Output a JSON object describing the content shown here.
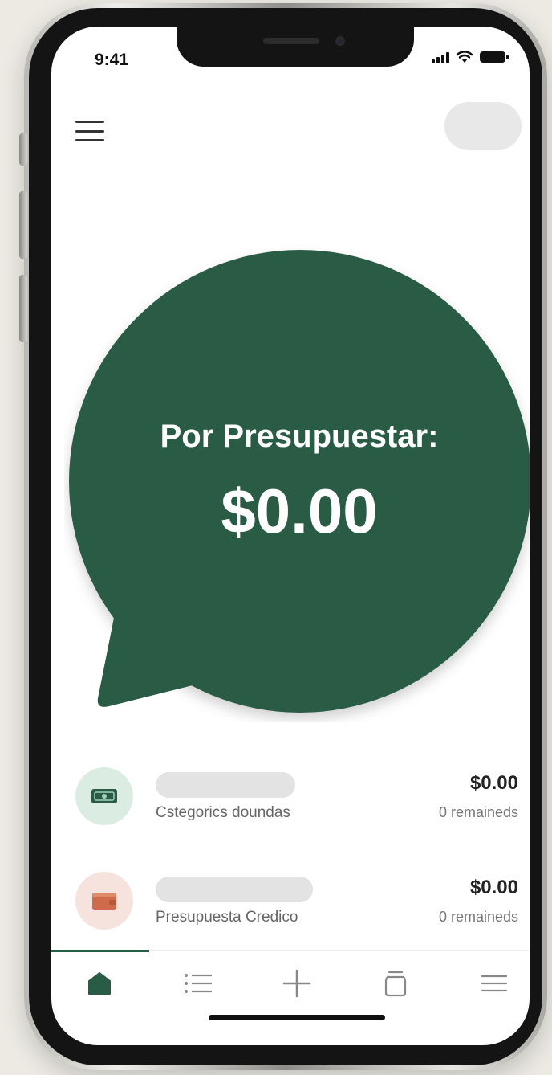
{
  "status_bar": {
    "time": "9:41"
  },
  "header": {
    "menu_icon": "hamburger-menu-icon",
    "avatar": "profile-placeholder"
  },
  "hero": {
    "label": "Por Presupuestar:",
    "amount": "$0.00",
    "color": "#2a5b45"
  },
  "budget_items": [
    {
      "icon": "cash-icon",
      "subtitle": "Cstegorics doundas",
      "amount": "$0.00",
      "remaining": "0 remaineds",
      "icon_bg": "#dbece3",
      "icon_color": "#2a5b45"
    },
    {
      "icon": "wallet-icon",
      "subtitle": "Presupuesta Credico",
      "amount": "$0.00",
      "remaining": "0 remaineds",
      "icon_bg": "#f6e3dd",
      "icon_color": "#cf6a4b"
    }
  ],
  "tab_bar": {
    "tabs": [
      "home-icon",
      "list-icon",
      "plus-icon",
      "cup-icon",
      "menu-icon"
    ],
    "active": "home-icon",
    "active_color": "#2a5b45"
  }
}
